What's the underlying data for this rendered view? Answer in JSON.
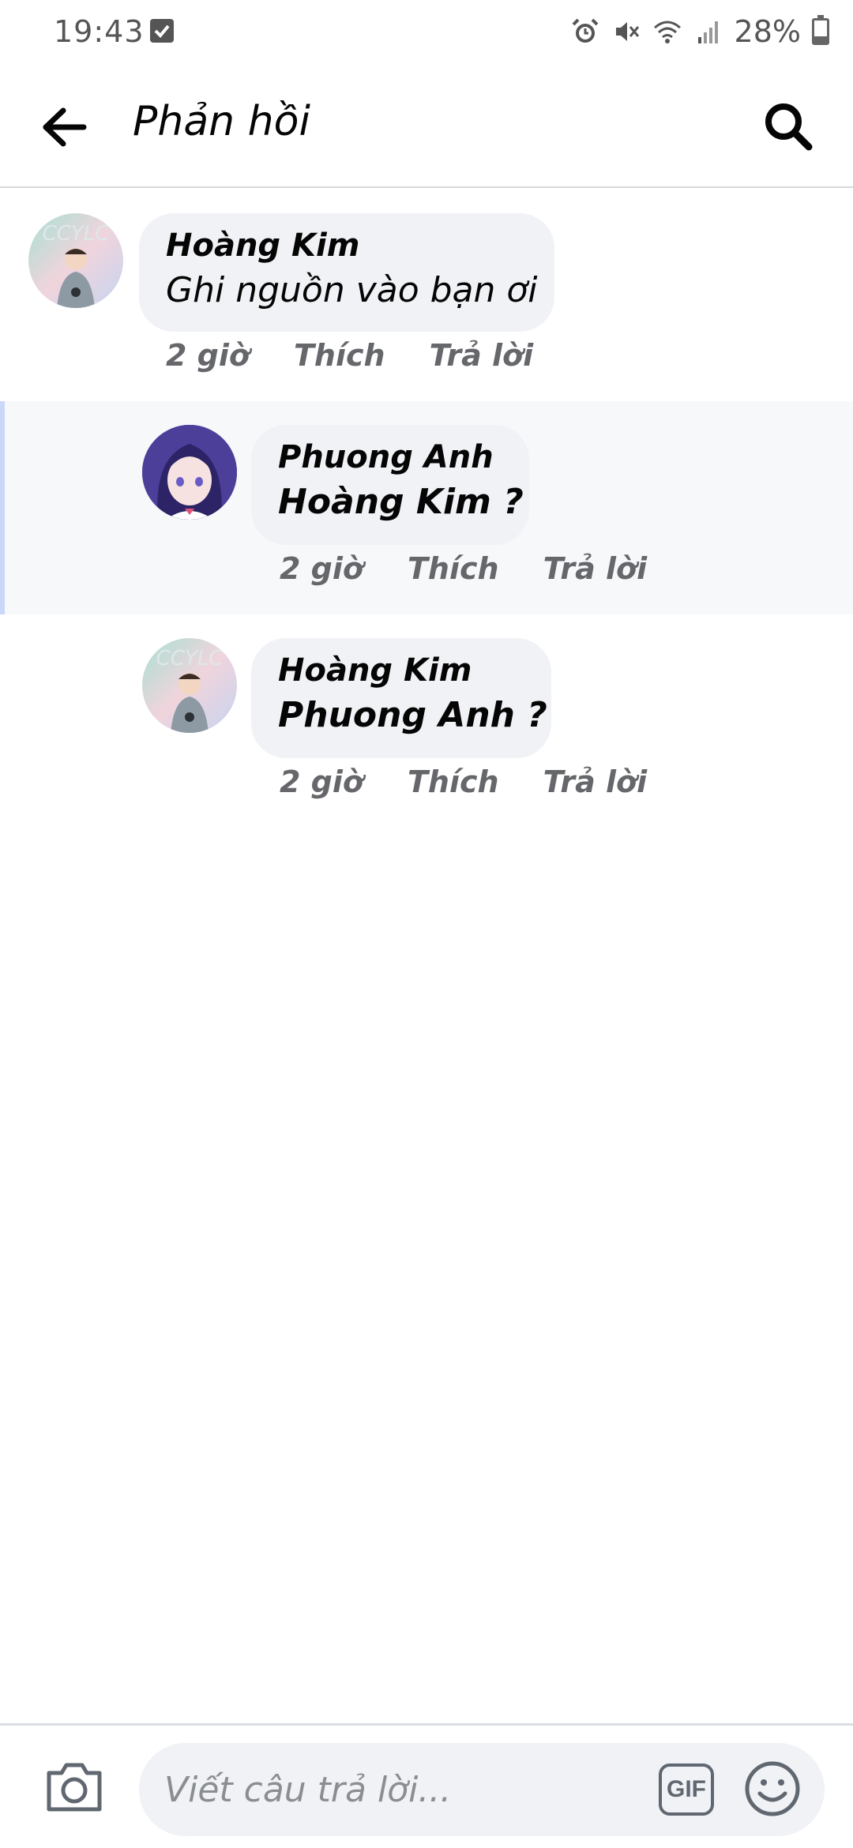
{
  "status_bar": {
    "time": "19:43",
    "battery": "28%",
    "battery_level": 0.28
  },
  "header": {
    "title": "Phản hồi",
    "back_icon": "arrow-left-icon",
    "search_icon": "search-icon"
  },
  "comments": [
    {
      "author": "Hoàng Kim",
      "text": "Ghi nguồn vào bạn ơi",
      "time": "2 giờ",
      "like": "Thích",
      "reply": "Trả lời"
    },
    {
      "author": "Phuong Anh",
      "text": "Hoàng Kim ?",
      "time": "2 giờ",
      "like": "Thích",
      "reply": "Trả lời"
    },
    {
      "author": "Hoàng Kim",
      "text": "Phuong Anh ?",
      "time": "2 giờ",
      "like": "Thích",
      "reply": "Trả lời"
    }
  ],
  "composer": {
    "placeholder": "Viết câu trả lời...",
    "gif_label": "GIF",
    "camera_icon": "camera-icon",
    "emoji_icon": "smiley-icon"
  },
  "colors": {
    "bubble": "#f0f2f5",
    "meta_text": "#65676b",
    "highlight_bar": "#c9d7f8"
  }
}
